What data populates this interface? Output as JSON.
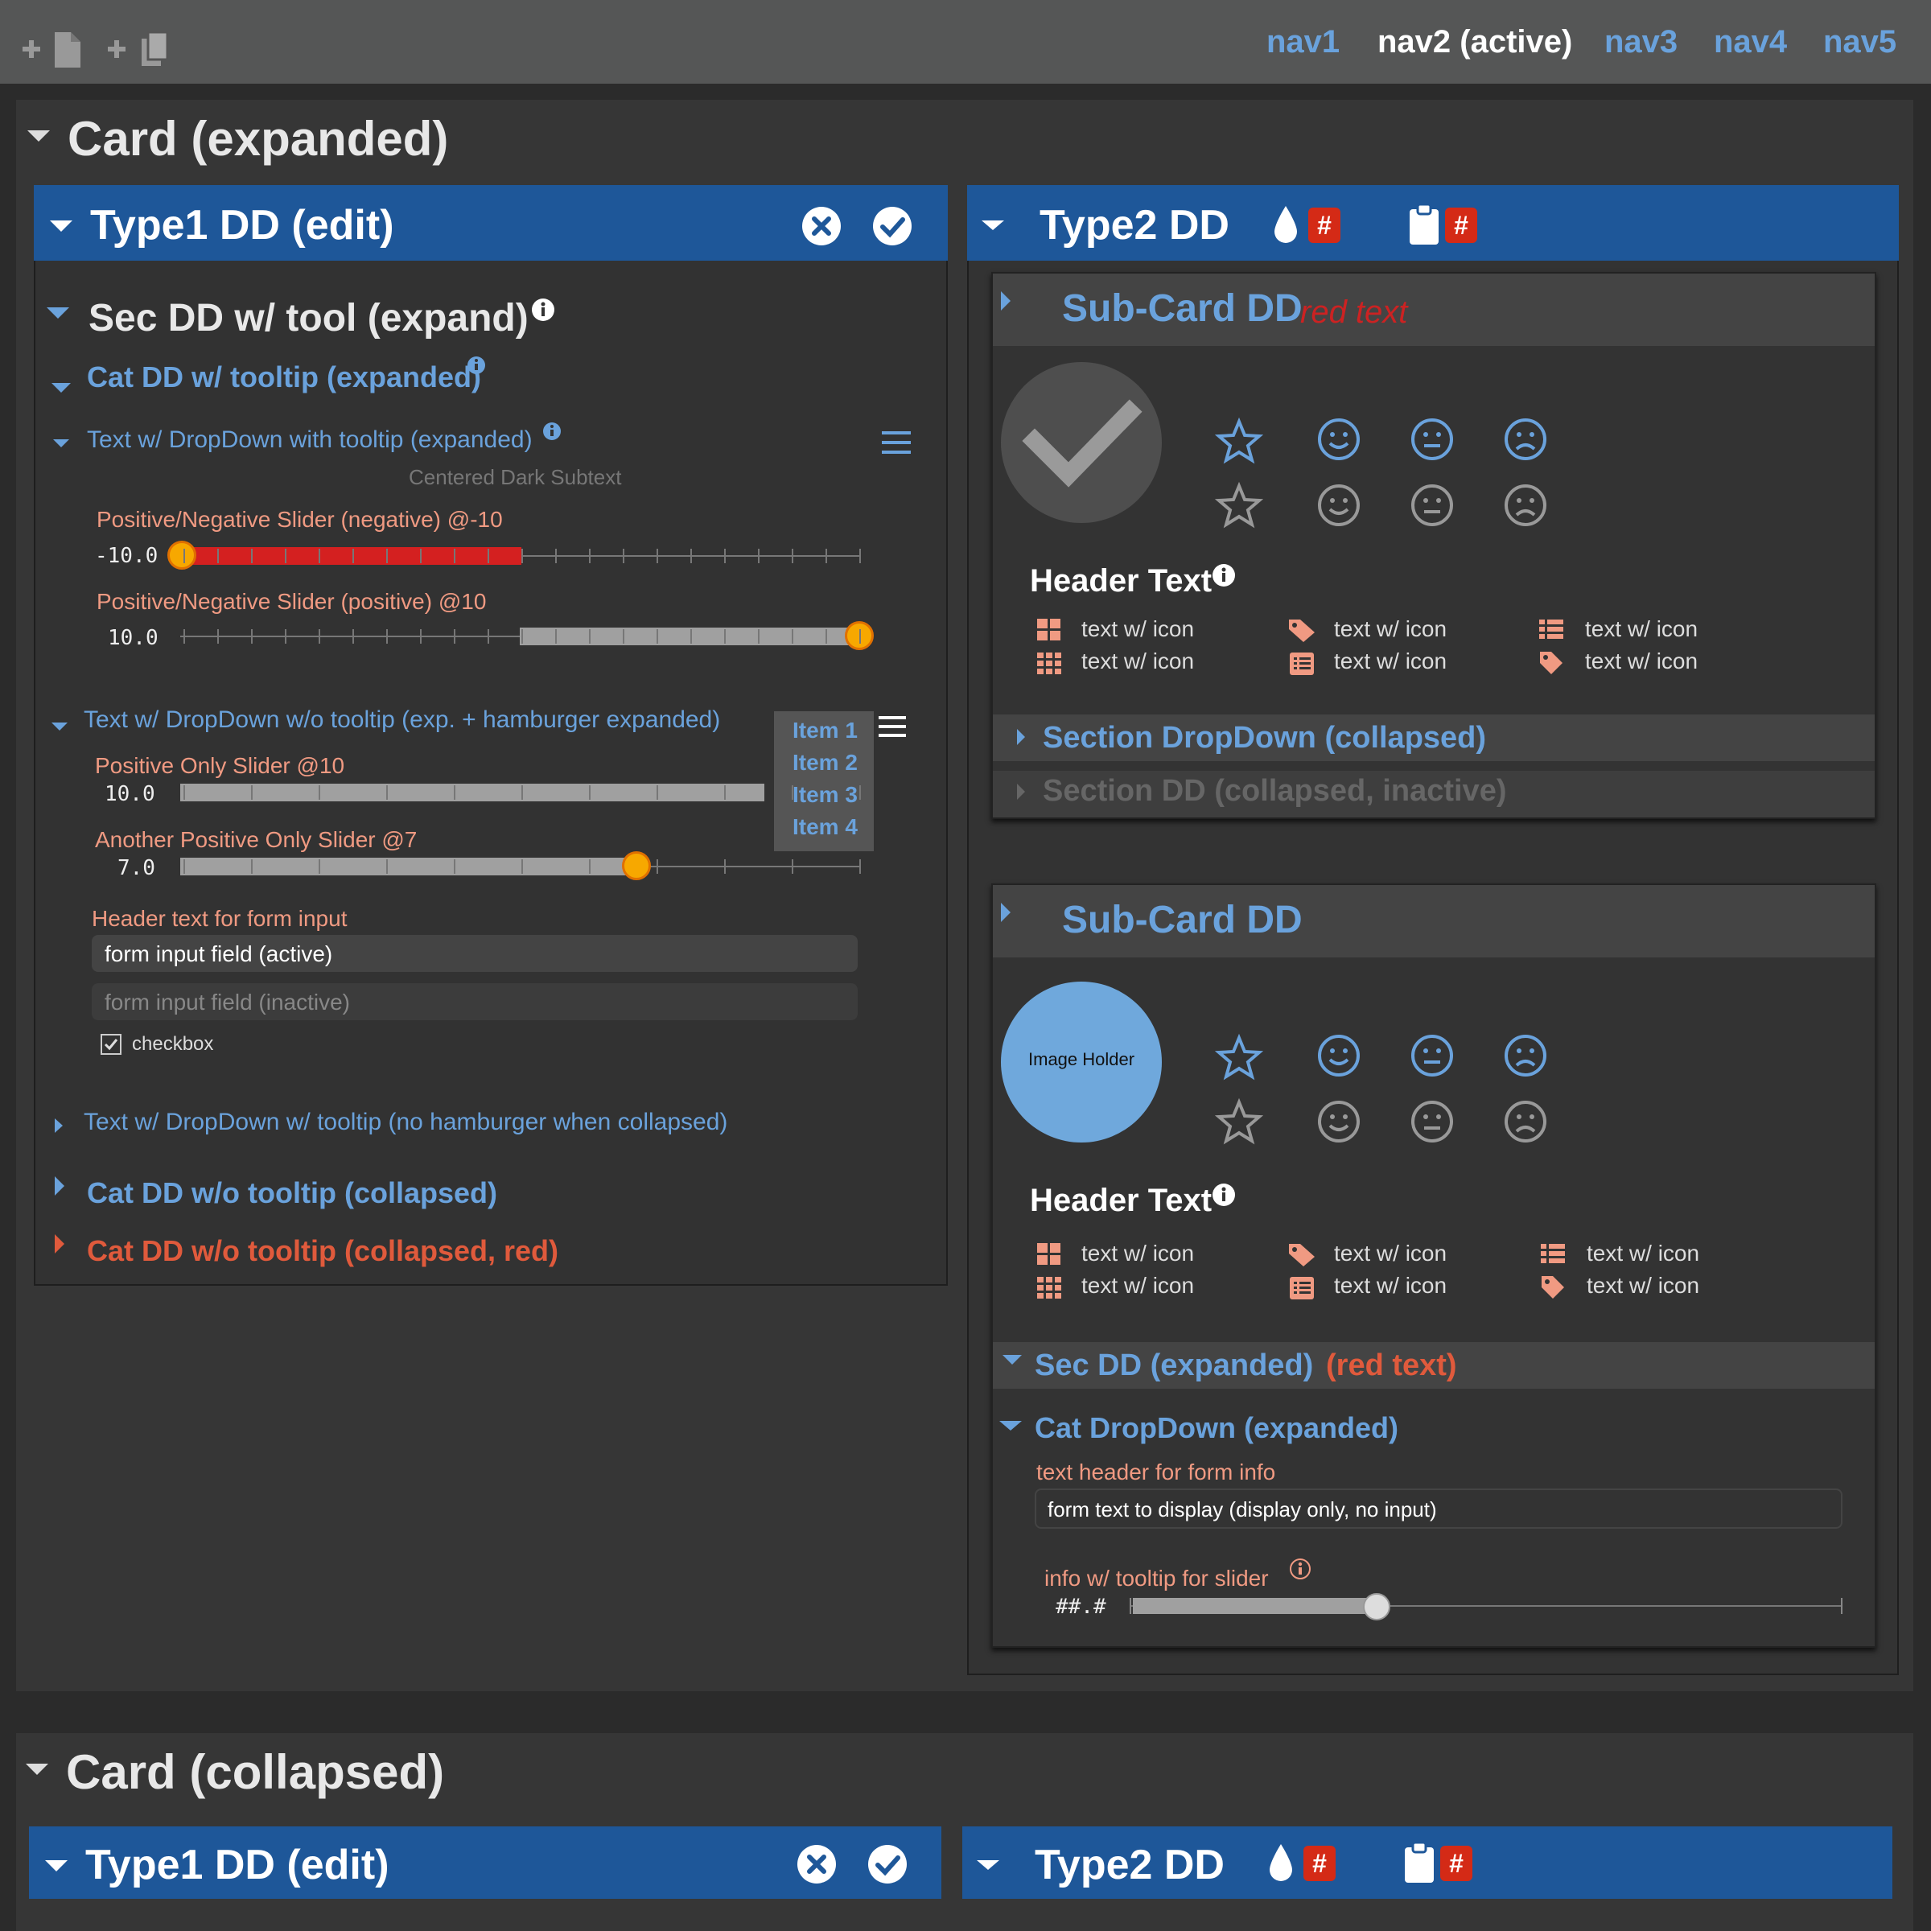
{
  "nav": {
    "items": [
      "nav1",
      "nav2 (active)",
      "nav3",
      "nav4",
      "nav5"
    ]
  },
  "card1": {
    "title": "Card (expanded)",
    "type1": {
      "title": "Type1 DD (edit)",
      "sec_title": "Sec DD w/ tool (expand)",
      "cat_title": "Cat DD w/ tooltip (expanded)",
      "text_dd1": "Text w/ DropDown with tooltip (expanded)",
      "subtext": "Centered Dark Subtext",
      "slider_neg_label": "Positive/Negative Slider (negative) @-10",
      "slider_neg_value": "-10.0",
      "slider_pos_label": "Positive/Negative Slider (positive) @10",
      "slider_pos_value": "10.0",
      "text_dd2": "Text w/ DropDown w/o tooltip (exp. + hamburger expanded)",
      "menu_items": [
        "Item 1",
        "Item 2",
        "Item 3",
        "Item 4"
      ],
      "pos_only_label": "Positive Only Slider @10",
      "pos_only_value": "10.0",
      "pos_only_level": 1.0,
      "another_label": "Another Positive Only Slider @7",
      "another_value": "7.0",
      "another_level": 0.7,
      "form_header": "Header text for form input",
      "input_active": "form input field (active)",
      "input_inactive_placeholder": "form input field (inactive)",
      "checkbox_label": "checkbox",
      "text_dd3": "Text w/ DropDown w/ tooltip (no hamburger when collapsed)",
      "cat_collapsed": "Cat DD w/o tooltip (collapsed)",
      "cat_collapsed_red": "Cat DD w/o tooltip (collapsed, red)"
    },
    "type2": {
      "title": "Type2 DD",
      "badge1": "#",
      "badge2": "#",
      "subcard1": {
        "title": "Sub-Card DD",
        "red_text": "red text",
        "header_text": "Header Text",
        "grid_items": [
          "text w/ icon",
          "text w/ icon",
          "text w/ icon",
          "text w/ icon",
          "text w/ icon",
          "text w/ icon"
        ],
        "section_collapsed": "Section DropDown (collapsed)",
        "section_inactive": "Section DD (collapsed, inactive)"
      },
      "subcard2": {
        "title": "Sub-Card DD",
        "image_holder": "Image Holder",
        "header_text": "Header Text",
        "grid_items": [
          "text w/ icon",
          "text w/ icon",
          "text w/ icon",
          "text w/ icon",
          "text w/ icon",
          "text w/ icon"
        ],
        "sec_expanded": "Sec DD (expanded)",
        "sec_red": "(red text)",
        "cat_expanded": "Cat DropDown (expanded)",
        "form_info_header": "text header for form info",
        "form_display": "form text to display (display only, no input)",
        "slider_info": "info w/ tooltip for slider",
        "slider_value": "##.#"
      }
    }
  },
  "card2": {
    "title": "Card (collapsed)",
    "type1_title": "Type1 DD (edit)",
    "type2_title": "Type2 DD",
    "badge1": "#",
    "badge2": "#"
  },
  "colors": {
    "accent": "#6aa2dc",
    "header_blue": "#1e5799",
    "salmon": "#f09a82",
    "badge_red": "#d42a16",
    "knob": "#f7a800"
  }
}
